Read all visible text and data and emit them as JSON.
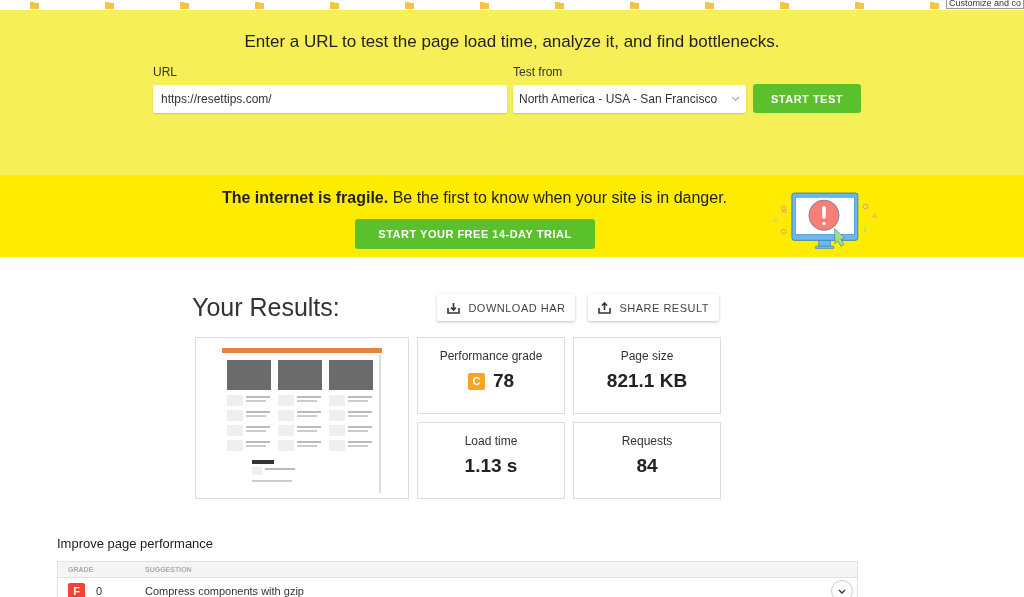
{
  "browser_bar": {
    "tooltip": "Customize and co"
  },
  "hero": {
    "subtitle": "Enter a URL to test the page load time, analyze it, and find bottlenecks.",
    "url_label": "URL",
    "url_value": "https://resettips.com/",
    "location_label": "Test from",
    "location_value": "North America - USA - San Francisco",
    "start_button": "START TEST"
  },
  "banner": {
    "text": "**The internet is fragile.** Be the first to know when your site is in danger.",
    "trial_button": "START YOUR FREE 14-DAY TRIAL"
  },
  "results": {
    "title": "Your Results:",
    "buttons": [
      {
        "kind": "download",
        "label": "DOWNLOAD HAR"
      },
      {
        "kind": "share",
        "label": "SHARE RESULT"
      }
    ],
    "metrics": [
      {
        "label": "Performance grade",
        "value": "78",
        "grade": "C"
      },
      {
        "label": "Page size",
        "value": "821.1 KB"
      },
      {
        "label": "Load time",
        "value": "1.13 s"
      },
      {
        "label": "Requests",
        "value": "84"
      }
    ]
  },
  "improve": {
    "title": "Improve page performance",
    "columns": [
      "GRADE",
      "SUGGESTION"
    ],
    "rows": [
      {
        "grade": "F",
        "score": "0",
        "suggestion": "Compress components with gzip"
      }
    ]
  }
}
